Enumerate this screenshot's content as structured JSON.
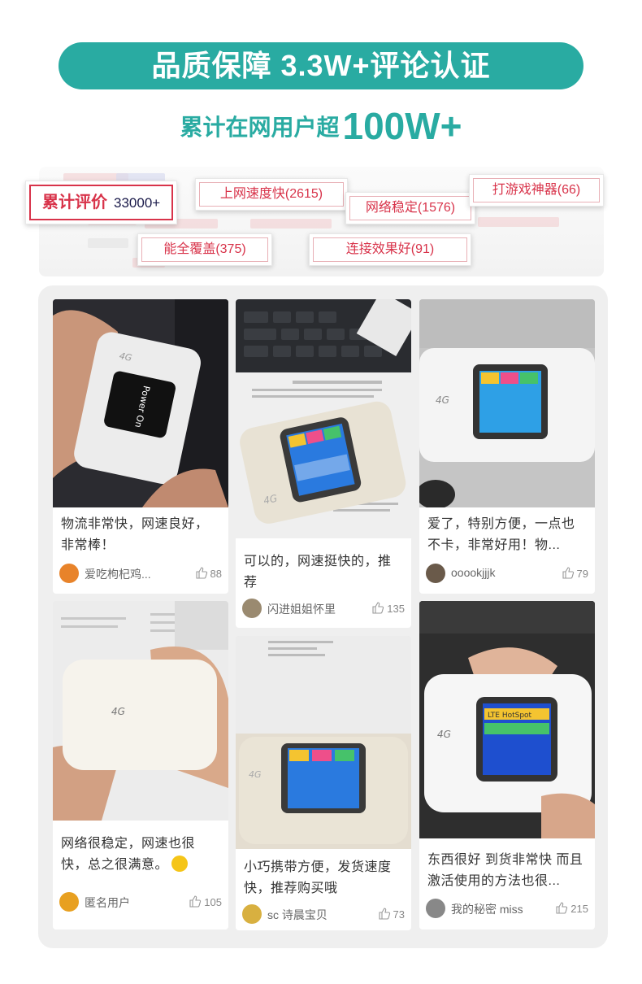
{
  "header": {
    "banner_text": "品质保障 3.3W+评论认证",
    "subtitle_prefix": "累计在网用户超",
    "subtitle_highlight": "100W+"
  },
  "tags": {
    "main_label": "累计评价",
    "main_count": "33000+",
    "items": [
      "上网速度快(2615)",
      "网络稳定(1576)",
      "打游戏神器(66)",
      "能全覆盖(375)",
      "连接效果好(91)"
    ]
  },
  "reviews": [
    {
      "text": "物流非常快，网速良好，非常棒！",
      "user": "爱吃枸杞鸡...",
      "likes": "88",
      "avatar_color": "#e8832a"
    },
    {
      "text": "可以的，网速挺快的，推荐",
      "user": "闪进姐姐怀里",
      "likes": "135",
      "avatar_color": "#9a8a70"
    },
    {
      "text": "爱了，特别方便，一点也不卡，非常好用！物...",
      "user": "ooookjjjk",
      "likes": "79",
      "avatar_color": "#6a5a4a"
    },
    {
      "text": "网络很稳定，网速也很快，总之很满意。",
      "user": "匿名用户",
      "likes": "105",
      "avatar_color": "#e8a020"
    },
    {
      "text": "小巧携带方便，发货速度快，推荐购买哦",
      "user": "sc 诗晨宝贝",
      "likes": "73",
      "avatar_color": "#d8b040"
    },
    {
      "text": "东西很好 到货非常快 而且激活使用的方法也很...",
      "user": "我的秘密 miss",
      "likes": "215",
      "avatar_color": "#888888"
    }
  ],
  "icons": {
    "like": "thumbs-up-icon",
    "smile": "smile-emoji-icon"
  },
  "colors": {
    "accent": "#29aba2",
    "tag_red": "#d8334a"
  }
}
